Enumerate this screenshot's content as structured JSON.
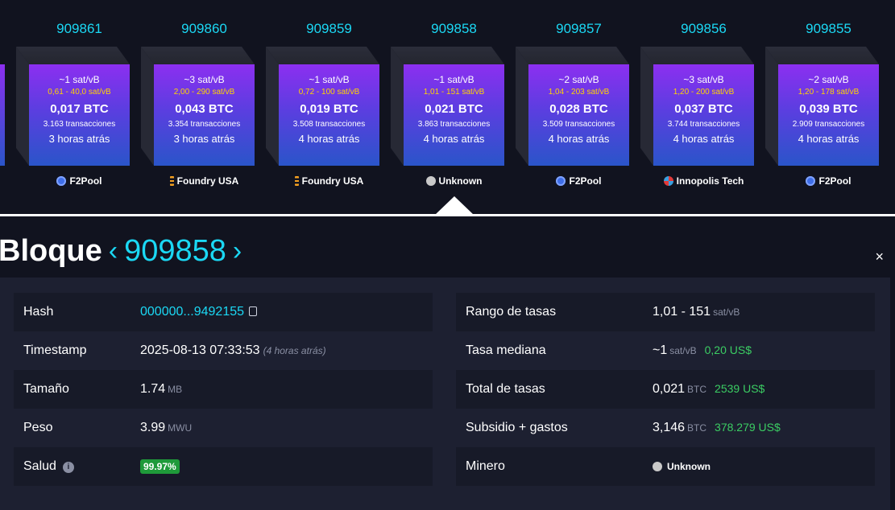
{
  "blocks": [
    {
      "height": "909861",
      "fee": "~1 sat/vB",
      "range": "0,61 - 40,0 sat/vB",
      "size": "0,017 BTC",
      "txs": "3.163 transacciones",
      "ago": "3 horas atrás",
      "miner": "F2Pool",
      "miner_icon": "f2pool-icon"
    },
    {
      "height": "909860",
      "fee": "~3 sat/vB",
      "range": "2,00 - 290 sat/vB",
      "size": "0,043 BTC",
      "txs": "3.354 transacciones",
      "ago": "3 horas atrás",
      "miner": "Foundry USA",
      "miner_icon": "foundry-icon"
    },
    {
      "height": "909859",
      "fee": "~1 sat/vB",
      "range": "0,72 - 100 sat/vB",
      "size": "0,019 BTC",
      "txs": "3.508 transacciones",
      "ago": "4 horas atrás",
      "miner": "Foundry USA",
      "miner_icon": "foundry-icon"
    },
    {
      "height": "909858",
      "fee": "~1 sat/vB",
      "range": "1,01 - 151 sat/vB",
      "size": "0,021 BTC",
      "txs": "3.863 transacciones",
      "ago": "4 horas atrás",
      "miner": "Unknown",
      "miner_icon": "unknown-miner-icon"
    },
    {
      "height": "909857",
      "fee": "~2 sat/vB",
      "range": "1,04 - 203 sat/vB",
      "size": "0,028 BTC",
      "txs": "3.509 transacciones",
      "ago": "4 horas atrás",
      "miner": "F2Pool",
      "miner_icon": "f2pool-icon"
    },
    {
      "height": "909856",
      "fee": "~3 sat/vB",
      "range": "1,20 - 200 sat/vB",
      "size": "0,037 BTC",
      "txs": "3.744 transacciones",
      "ago": "4 horas atrás",
      "miner": "Innopolis Tech",
      "miner_icon": "innopolis-icon"
    },
    {
      "height": "909855",
      "fee": "~2 sat/vB",
      "range": "1,20 - 178 sat/vB",
      "size": "0,039 BTC",
      "txs": "2.909 transacciones",
      "ago": "4 horas atrás",
      "miner": "F2Pool",
      "miner_icon": "f2pool-icon"
    }
  ],
  "detail": {
    "title": "Bloque",
    "height": "909858",
    "prev_arrow": "‹",
    "next_arrow": "›",
    "close": "×",
    "left": {
      "hash_label": "Hash",
      "hash_value": "000000...9492155",
      "timestamp_label": "Timestamp",
      "timestamp_value": "2025-08-13 07:33:53",
      "timestamp_ago": "(4 horas atrás)",
      "size_label": "Tamaño",
      "size_value": "1.74",
      "size_unit": "MB",
      "weight_label": "Peso",
      "weight_value": "3.99",
      "weight_unit": "MWU",
      "health_label": "Salud",
      "health_value": "99.97%"
    },
    "right": {
      "fee_range_label": "Rango de tasas",
      "fee_range_value": "1,01 - 151",
      "fee_range_unit": "sat/vB",
      "median_label": "Tasa mediana",
      "median_value": "~1",
      "median_unit": "sat/vB",
      "median_usd": "0,20 US$",
      "total_fees_label": "Total de tasas",
      "total_fees_value": "0,021",
      "total_fees_unit": "BTC",
      "total_fees_usd": "2539 US$",
      "subsidy_label": "Subsidio + gastos",
      "subsidy_value": "3,146",
      "subsidy_unit": "BTC",
      "subsidy_usd": "378.279 US$",
      "miner_label": "Minero",
      "miner_value": "Unknown"
    }
  },
  "colors": {
    "accent": "#1bd8f4",
    "bg": "#11131f",
    "panel": "#1d2031",
    "positive": "#3bcd63",
    "fee_range": "#ffd400"
  }
}
